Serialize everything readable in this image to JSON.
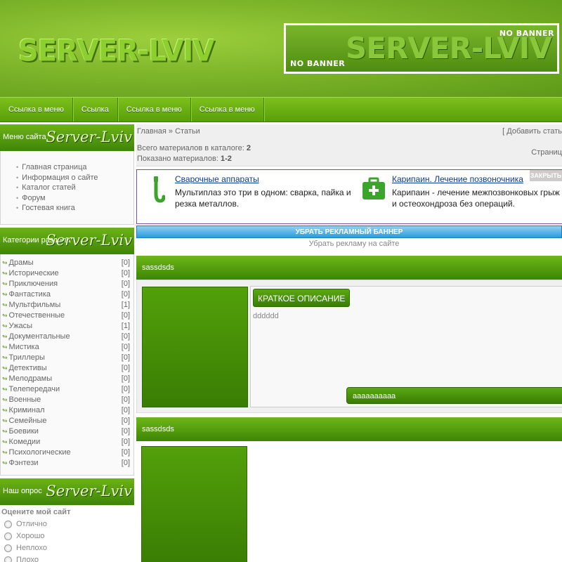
{
  "header": {
    "logo": "SERVER-LVIV",
    "banner_logo": "SERVER-LVIV",
    "banner_top": "NO BANNER",
    "banner_bottom": "NO BANNER"
  },
  "nav": [
    "Ссылка в меню",
    "Ссылка",
    "Ссылка в меню",
    "Ссылка в меню"
  ],
  "sidebar": {
    "menu": {
      "title": "Меню сайта",
      "logo": "Server-Lviv",
      "items": [
        "Главная страница",
        "Информация о сайте",
        "Каталог статей",
        "Форум",
        "Гостевая книга"
      ]
    },
    "categories": {
      "title": "Категории раздела",
      "logo": "Server-Lviv",
      "items": [
        {
          "name": "Драмы",
          "count": "[0]"
        },
        {
          "name": "Исторические",
          "count": "[0]"
        },
        {
          "name": "Приключения",
          "count": "[0]"
        },
        {
          "name": "Фантастика",
          "count": "[0]"
        },
        {
          "name": "Мультфильмы",
          "count": "[1]"
        },
        {
          "name": "Отечественные",
          "count": "[0]"
        },
        {
          "name": "Ужасы",
          "count": "[1]"
        },
        {
          "name": "Документальные",
          "count": "[0]"
        },
        {
          "name": "Мистика",
          "count": "[0]"
        },
        {
          "name": "Триллеры",
          "count": "[0]"
        },
        {
          "name": "Детективы",
          "count": "[0]"
        },
        {
          "name": "Мелодрамы",
          "count": "[0]"
        },
        {
          "name": "Телепередачи",
          "count": "[0]"
        },
        {
          "name": "Военные",
          "count": "[0]"
        },
        {
          "name": "Криминал",
          "count": "[0]"
        },
        {
          "name": "Семейные",
          "count": "[0]"
        },
        {
          "name": "Боевики",
          "count": "[0]"
        },
        {
          "name": "Комедии",
          "count": "[0]"
        },
        {
          "name": "Психологические",
          "count": "[0]"
        },
        {
          "name": "Фэнтези",
          "count": "[0]"
        }
      ]
    },
    "poll": {
      "title": "Наш опрос",
      "logo": "Server-Lviv",
      "question": "Оцените мой сайт",
      "options": [
        "Отлично",
        "Хорошо",
        "Неплохо",
        "Плохо"
      ]
    }
  },
  "main": {
    "breadcrumb": "Главная » Статьи",
    "add_link": "[ Добавить стать",
    "total_label": "Всего материалов в каталоге:",
    "total_value": "2",
    "shown_label": "Показано материалов:",
    "shown_value": "1-2",
    "pages_label": "Страниц",
    "ad": {
      "close": "ЗАКРЫТЬ",
      "item1_title": "Сварочные аппараты",
      "item1_desc": "Мультиплаз это три в одном: сварка, пайка и резка металлов.",
      "item2_title": "Карипаин. Лечение позвоночника",
      "item2_desc": "Карипаин - лечение межпозвонковых грыж и остеохондроза без операций.",
      "remove_bar": "УБРАТЬ РЕКЛАМНЫЙ БАННЕР",
      "remove_link": "Убрать рекламу на сайте"
    },
    "posts": [
      {
        "title": "sassdsds",
        "desc_label": "КРАТКОЕ ОПИСАНИЕ",
        "desc_text": "dddddd",
        "more": "aaaaaaaaaa"
      },
      {
        "title": "sassdsds"
      }
    ]
  },
  "colors": {
    "accent_green": "#5aa814",
    "ad_blue": "#2b9bdc",
    "link_blue": "#0a3a9a"
  }
}
